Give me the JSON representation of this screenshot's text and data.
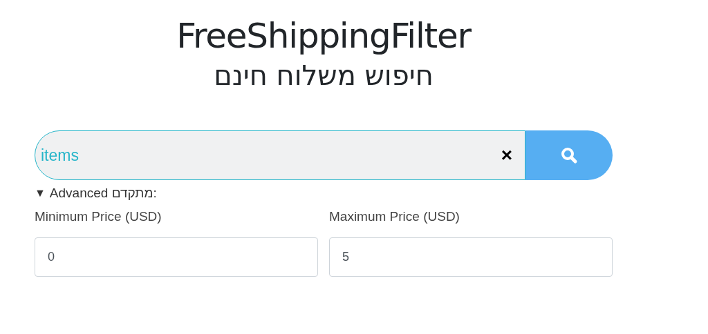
{
  "title": "FreeShippingFilter",
  "subtitle": "חיפוש משלוח חינם",
  "search": {
    "value": "items",
    "clear": "×"
  },
  "advanced": {
    "marker": "▼",
    "label": "Advanced מתקדם:",
    "expanded": true,
    "min_price": {
      "label": "Minimum Price (USD)",
      "value": "0"
    },
    "max_price": {
      "label": "Maximum Price (USD)",
      "value": "5"
    }
  }
}
